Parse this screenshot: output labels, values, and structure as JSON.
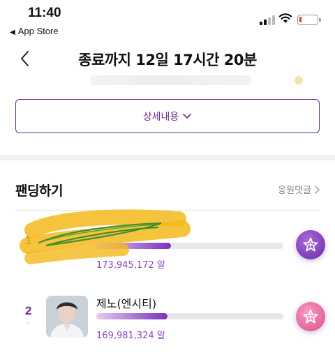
{
  "status_bar": {
    "time": "11:40",
    "back_app": "App Store",
    "battery_color": "#e03a2f"
  },
  "header": {
    "back_icon": "chevron-left-icon",
    "title": "종료까지 12일 17시간 20분"
  },
  "detail_button": {
    "label": "상세내용",
    "icon": "chevron-down-icon"
  },
  "section": {
    "title": "팬딩하기",
    "comments_link": "응원댓글",
    "comments_icon": "chevron-right-icon"
  },
  "rankings": [
    {
      "rank": "1",
      "name": "",
      "votes_text": "173,945,172 알",
      "progress": 0.4,
      "vote_icon": "star-vote-icon",
      "vote_color": "#7b3db4"
    },
    {
      "rank": "2",
      "rank_change": "-",
      "name": "제노(엔시티)",
      "votes_text": "169,981,324 알",
      "progress": 0.38,
      "vote_icon": "star-vote-icon",
      "vote_color": "#e0609a"
    }
  ],
  "colors": {
    "accent": "#6a2c91",
    "vote_text": "#8e44c4",
    "highlighter_yellow": "#f4b81a",
    "scribble_green": "#2f8a2a"
  }
}
